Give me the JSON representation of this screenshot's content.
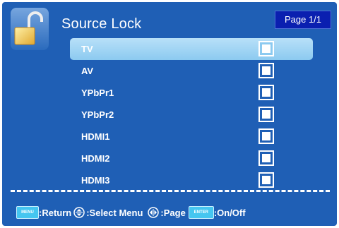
{
  "header": {
    "title": "Source Lock",
    "page": "Page 1/1"
  },
  "sources": [
    {
      "label": "TV",
      "locked": true,
      "selected": true
    },
    {
      "label": "AV",
      "locked": true,
      "selected": false
    },
    {
      "label": "YPbPr1",
      "locked": true,
      "selected": false
    },
    {
      "label": "YPbPr2",
      "locked": true,
      "selected": false
    },
    {
      "label": "HDMI1",
      "locked": true,
      "selected": false
    },
    {
      "label": "HDMI2",
      "locked": true,
      "selected": false
    },
    {
      "label": "HDMI3",
      "locked": true,
      "selected": false
    }
  ],
  "footer": {
    "menu_key": "MENU",
    "return_label": ":Return",
    "select_label": ":Select Menu",
    "page_label": ":Page",
    "enter_key": "ENTER",
    "onoff_label": ":On/Off"
  },
  "colors": {
    "background": "#1f5fb5",
    "selection": "#8ccaf0",
    "page_badge": "#0a1fb0",
    "key_cap": "#45c6f0"
  },
  "icons": [
    "padlock-open-icon",
    "up-down-arrows-icon",
    "left-right-arrows-icon",
    "checkbox-icon"
  ]
}
